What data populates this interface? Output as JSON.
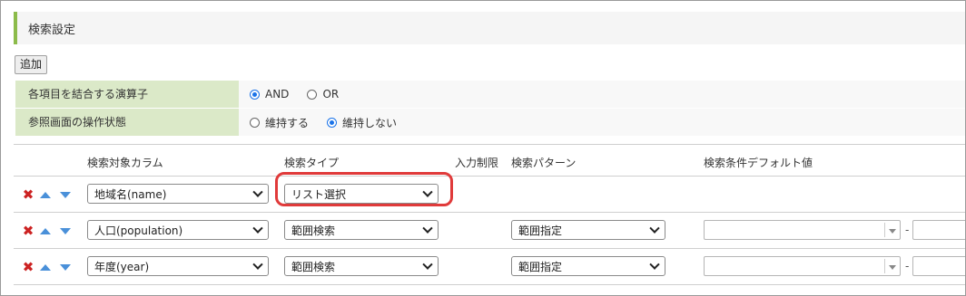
{
  "section": {
    "title": "検索設定"
  },
  "toolbar": {
    "add_label": "追加"
  },
  "settings": {
    "operator": {
      "label": "各項目を結合する演算子",
      "options": [
        {
          "label": "AND",
          "checked": true
        },
        {
          "label": "OR",
          "checked": false
        }
      ]
    },
    "view_state": {
      "label": "参照画面の操作状態",
      "options": [
        {
          "label": "維持する",
          "checked": false
        },
        {
          "label": "維持しない",
          "checked": true
        }
      ]
    }
  },
  "grid": {
    "headers": {
      "column": "検索対象カラム",
      "type": "検索タイプ",
      "input_limit": "入力制限",
      "pattern": "検索パターン",
      "default_value": "検索条件デフォルト値"
    },
    "rows": [
      {
        "column": "地域名(name)",
        "type": "リスト選択",
        "pattern": "",
        "highlighted": true
      },
      {
        "column": "人口(population)",
        "type": "範囲検索",
        "pattern": "範囲指定",
        "range_separator": "-"
      },
      {
        "column": "年度(year)",
        "type": "範囲検索",
        "pattern": "範囲指定",
        "range_separator": "-"
      }
    ]
  },
  "colors": {
    "accent_bar": "#8cbb4a",
    "label_bg": "#dbe9c8",
    "highlight_border": "#e03a3a",
    "delete_icon": "#cc2222",
    "arrow_icons": "#4a90d9",
    "radio_checked": "#1a73e8"
  },
  "icons": {
    "delete": "close-x-icon",
    "move_up": "triangle-up-icon",
    "move_down": "triangle-down-icon"
  }
}
